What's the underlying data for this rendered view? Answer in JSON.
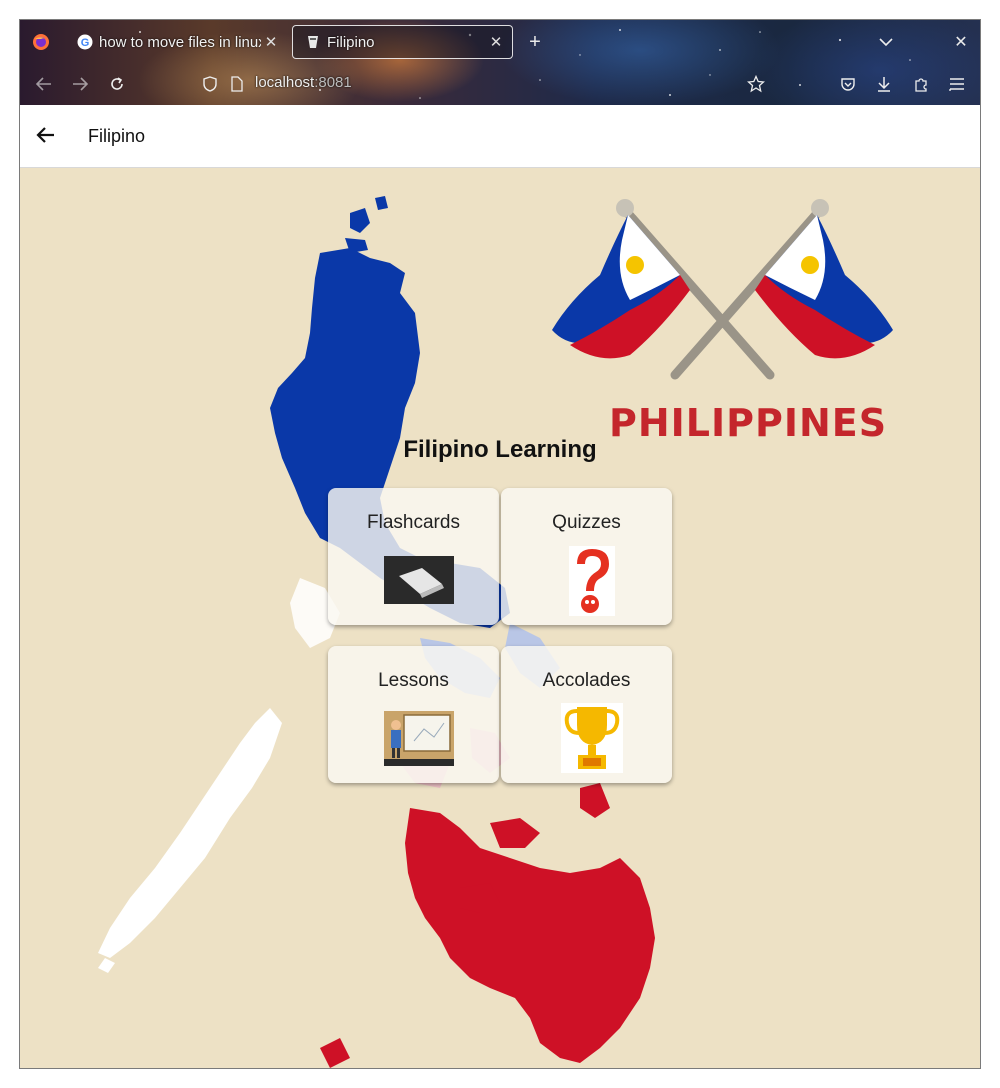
{
  "browser": {
    "tabs": [
      {
        "title": "how to move files in linux",
        "active": false
      },
      {
        "title": "Filipino",
        "active": true
      }
    ],
    "url_host": "localhost",
    "url_port": ":8081"
  },
  "appbar": {
    "title": "Filipino"
  },
  "page": {
    "banner_text": "PHILIPPINES",
    "heading": "Filipino Learning",
    "cards": [
      {
        "label": "Flashcards",
        "icon": "flashcards-icon"
      },
      {
        "label": "Quizzes",
        "icon": "question-mark-icon"
      },
      {
        "label": "Lessons",
        "icon": "teacher-icon"
      },
      {
        "label": "Accolades",
        "icon": "trophy-icon"
      }
    ]
  },
  "colors": {
    "flag_blue": "#0a38a8",
    "flag_red": "#ce1126",
    "background": "#ede1c5",
    "gold": "#f5b800"
  }
}
